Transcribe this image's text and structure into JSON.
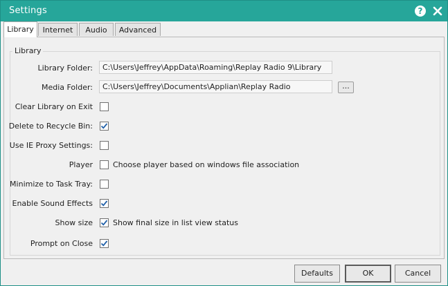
{
  "window": {
    "title": "Settings"
  },
  "tabs": [
    {
      "label": "Library",
      "active": true
    },
    {
      "label": "Internet",
      "active": false
    },
    {
      "label": "Audio",
      "active": false
    },
    {
      "label": "Advanced",
      "active": false
    }
  ],
  "library": {
    "group_title": "Library",
    "library_folder": {
      "label": "Library Folder:",
      "value": "C:\\Users\\Jeffrey\\AppData\\Roaming\\Replay Radio 9\\Library"
    },
    "media_folder": {
      "label": "Media Folder:",
      "value": "C:\\Users\\Jeffrey\\Documents\\Applian\\Replay Radio",
      "browse_label": "..."
    },
    "options": [
      {
        "label": "Clear Library on Exit",
        "checked": false,
        "text": ""
      },
      {
        "label": "Delete to Recycle Bin:",
        "checked": true,
        "text": ""
      },
      {
        "label": "Use IE Proxy Settings:",
        "checked": false,
        "text": ""
      },
      {
        "label": "Player",
        "checked": false,
        "text": "Choose player based on windows file association"
      },
      {
        "label": "Minimize to Task Tray:",
        "checked": false,
        "text": ""
      },
      {
        "label": "Enable Sound Effects",
        "checked": true,
        "text": ""
      },
      {
        "label": "Show size",
        "checked": true,
        "text": "Show final size in list view status"
      },
      {
        "label": "Prompt on Close",
        "checked": true,
        "text": ""
      }
    ]
  },
  "buttons": {
    "defaults": "Defaults",
    "ok": "OK",
    "cancel": "Cancel"
  },
  "icons": {
    "help": "help-icon",
    "close": "close-icon",
    "check": "checkmark-icon"
  },
  "colors": {
    "titlebar": "#26a69a",
    "check": "#1f5fa8"
  }
}
